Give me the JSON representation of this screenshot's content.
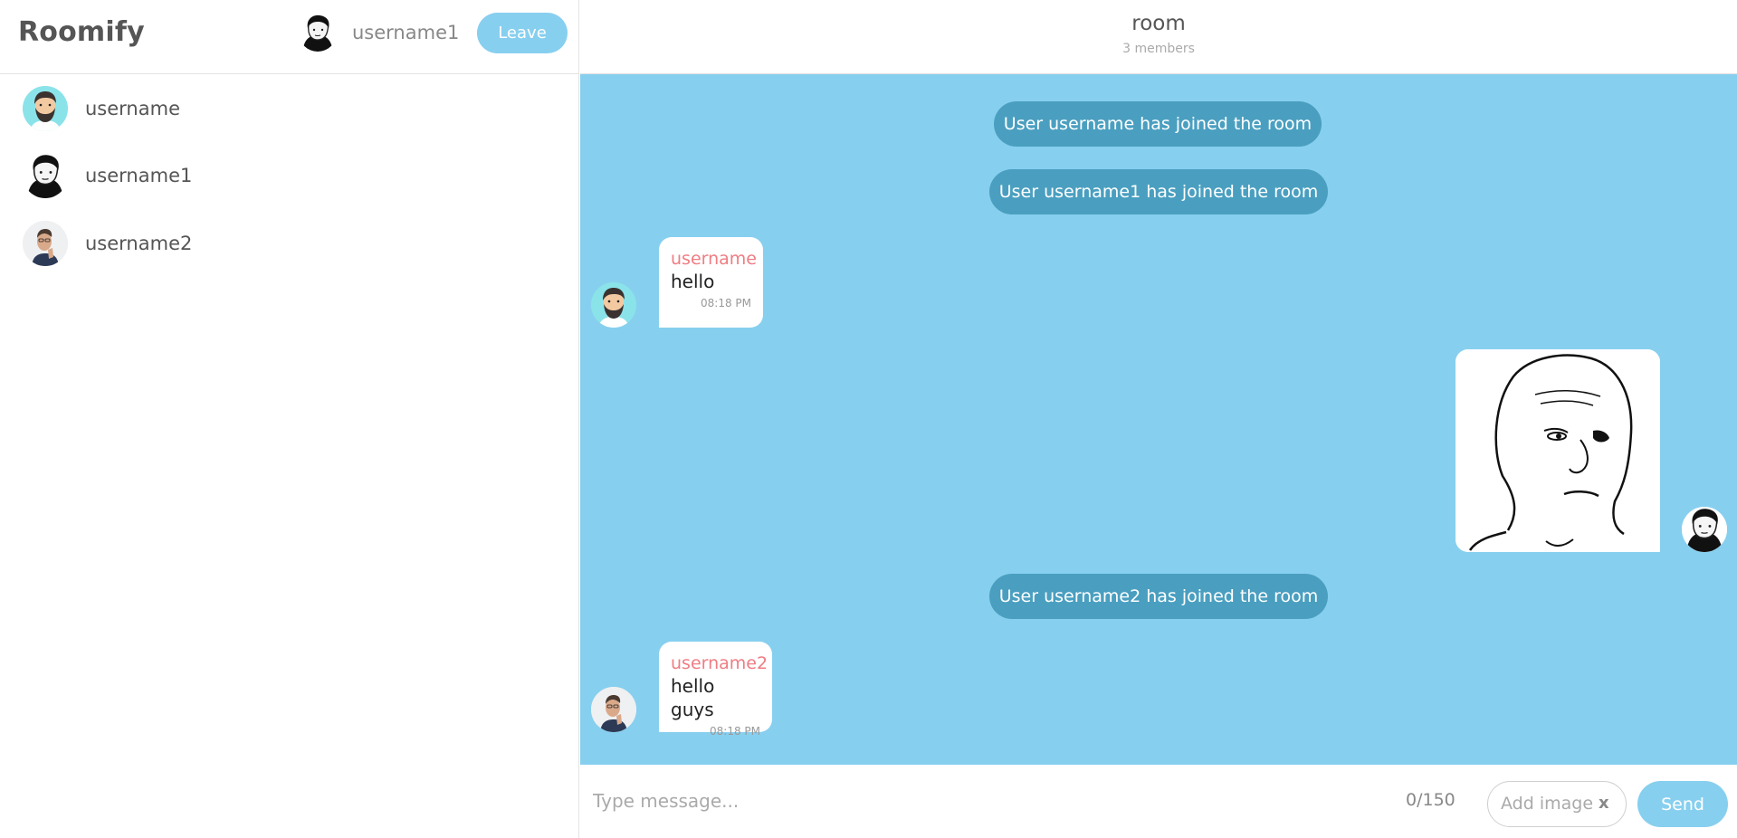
{
  "app": {
    "brand": "Roomify"
  },
  "current_user": {
    "name": "username1",
    "avatar": "avatar-wojak-icon"
  },
  "header": {
    "leave_label": "Leave"
  },
  "sidebar": {
    "members": [
      {
        "name": "username",
        "avatar": "avatar-bearded-man-icon"
      },
      {
        "name": "username1",
        "avatar": "avatar-wojak-icon"
      },
      {
        "name": "username2",
        "avatar": "avatar-man-photo-icon"
      }
    ]
  },
  "room": {
    "name": "room",
    "members_count": "3 members"
  },
  "messages": [
    {
      "type": "system",
      "text": "User username has joined the room"
    },
    {
      "type": "system",
      "text": "User username1 has joined the room"
    },
    {
      "type": "message",
      "author": "username",
      "text": "hello",
      "time": "08:18 PM",
      "side": "left"
    },
    {
      "type": "image",
      "author": "username1",
      "image": "wojak-drawing-image",
      "side": "right"
    },
    {
      "type": "system",
      "text": "User username2 has joined the room"
    },
    {
      "type": "message",
      "author": "username2",
      "text": "hello guys",
      "time": "08:18 PM",
      "side": "left"
    }
  ],
  "composer": {
    "placeholder": "Type message...",
    "counter": "0/150",
    "add_image_label": "Add image",
    "clear_label": "x",
    "send_label": "Send"
  },
  "colors": {
    "accent": "#87cfef",
    "system_pill": "#4a9fc0",
    "author": "#ef7d83"
  }
}
